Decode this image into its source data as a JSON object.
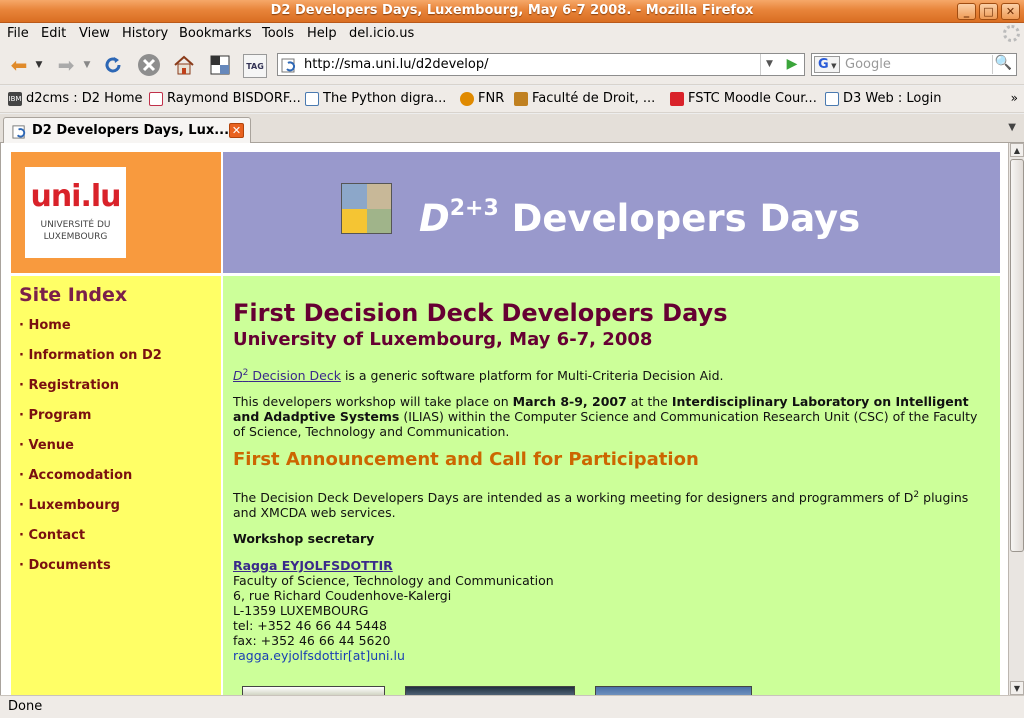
{
  "window": {
    "title": "D2 Developers Days, Luxembourg, May 6-7 2008. - Mozilla Firefox",
    "min": "_",
    "max": "□",
    "close": "✕"
  },
  "menu": [
    "File",
    "Edit",
    "View",
    "History",
    "Bookmarks",
    "Tools",
    "Help",
    "del.icio.us"
  ],
  "toolbar": {
    "url": "http://sma.uni.lu/d2develop/",
    "search_placeholder": "Google",
    "search_engine": "G",
    "tag_label": "TAG"
  },
  "bookmarks": [
    {
      "label": "d2cms : D2 Home",
      "icon": "ibm-icon",
      "color": "#444444"
    },
    {
      "label": "Raymond BISDORF...",
      "icon": "page-icon",
      "color": "#c0304a"
    },
    {
      "label": "The Python digra...",
      "icon": "refresh-page-icon",
      "color": "#4a7ab0"
    },
    {
      "label": "FNR",
      "icon": "fnr-icon",
      "color": "#e08a00"
    },
    {
      "label": "Faculté de Droit, ...",
      "icon": "faculty-icon",
      "color": "#c08020"
    },
    {
      "label": "FSTC Moodle Cour...",
      "icon": "unilu-icon",
      "color": "#d9222a"
    },
    {
      "label": "D3 Web : Login",
      "icon": "refresh-page-icon",
      "color": "#4a7ab0"
    }
  ],
  "tab": {
    "label": "D2 Developers Days, Lux...",
    "close": "✕"
  },
  "status": "Done",
  "page": {
    "logo_text": "uni.lu",
    "logo_line1": "UNIVERSITÉ DU",
    "logo_line2": "LUXEMBOURG",
    "header_d": "D",
    "header_sup": "2+3",
    "header_rest": " Developers Days",
    "site_index_title": "Site Index",
    "nav": [
      "· Home",
      "· Information on D2",
      "· Registration",
      "· Program",
      "· Venue",
      "· Accomodation",
      "· Luxembourg",
      "· Contact",
      "· Documents"
    ],
    "title": "First Decision Deck Developers Days",
    "subtitle": "University of Luxembourg, May 6-7, 2008",
    "intro_link_d": "D",
    "intro_link_sup": "2",
    "intro_link_rest": " Decision Deck",
    "intro_text": " is a generic software platform for Multi-Criteria Decision Aid.",
    "p2_a": "This developers workshop will take place on ",
    "p2_date": "March 8-9, 2007",
    "p2_b": " at the ",
    "p2_lab": "Interdisciplinary Laboratory on Intelligent and Adadptive Systems",
    "p2_c": " (ILIAS) within the Computer Science and Communication Research Unit (CSC) of the Faculty of Science, Technology and Communication.",
    "announcement": "First Announcement and Call for Participation",
    "p3_a": "The Decision Deck Developers Days are intended as a working meeting for designers and programmers of D",
    "p3_sup": "2",
    "p3_b": " plugins and XMCDA web services.",
    "secretary_heading": "Workshop secretary",
    "secretary_name": "Ragga EYJOLFSDOTTIR",
    "address": [
      "Faculty of Science, Technology and Communication",
      "6, rue Richard Coudenhove-Kalergi",
      "L-1359 LUXEMBOURG",
      "tel: +352 46 66 44 5448",
      "fax: +352 46 66 44 5620"
    ],
    "email": "ragga.eyjolfsdottir[at]uni.lu"
  },
  "colors": {
    "logo_bg": "#f89a3e",
    "header_bg": "#9999cc",
    "sidebar_bg": "#ffff66",
    "main_bg": "#ccff99",
    "heading": "#660033",
    "announcement": "#cc6600"
  }
}
